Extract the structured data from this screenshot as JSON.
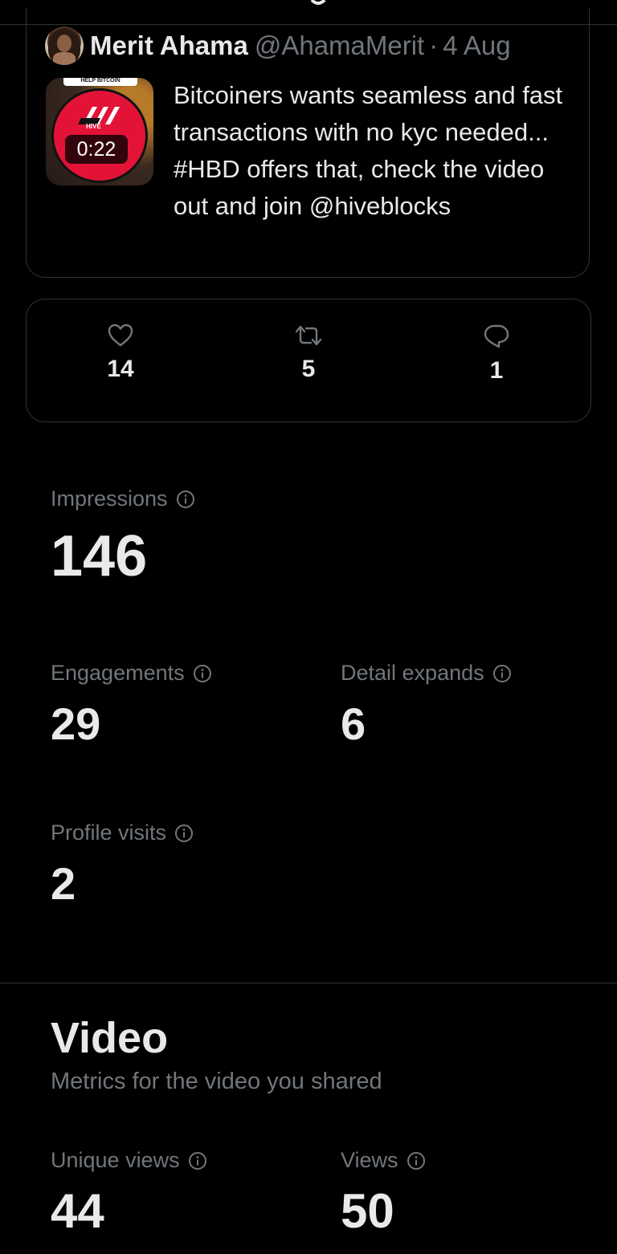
{
  "tweet": {
    "author_name": "Merit Ahama",
    "author_handle": "@AhamaMerit",
    "separator": "·",
    "date": "4 Aug",
    "text": "Bitcoiners wants seamless and fast transactions with no kyc needed... #HBD offers that, check the video out and join @hiveblocks",
    "thumbnail": {
      "banner_text": "HELP BITCOIN",
      "logo_text": "HIVE",
      "duration": "0:22"
    }
  },
  "engagement": {
    "likes": {
      "icon": "heart-icon",
      "count": "14"
    },
    "reposts": {
      "icon": "repost-icon",
      "count": "5"
    },
    "replies": {
      "icon": "reply-icon",
      "count": "1"
    }
  },
  "metrics": {
    "impressions": {
      "label": "Impressions",
      "value": "146"
    },
    "engagements": {
      "label": "Engagements",
      "value": "29"
    },
    "detail_expands": {
      "label": "Detail expands",
      "value": "6"
    },
    "profile_visits": {
      "label": "Profile visits",
      "value": "2"
    }
  },
  "video": {
    "title": "Video",
    "subtitle": "Metrics for the video you shared",
    "unique_views": {
      "label": "Unique views",
      "value": "44"
    },
    "views": {
      "label": "Views",
      "value": "50"
    }
  },
  "colors": {
    "background": "#000000",
    "primary_text": "#e7e9ea",
    "secondary_text": "#71767b",
    "border": "#2f3336",
    "hive_red": "#e31337"
  }
}
